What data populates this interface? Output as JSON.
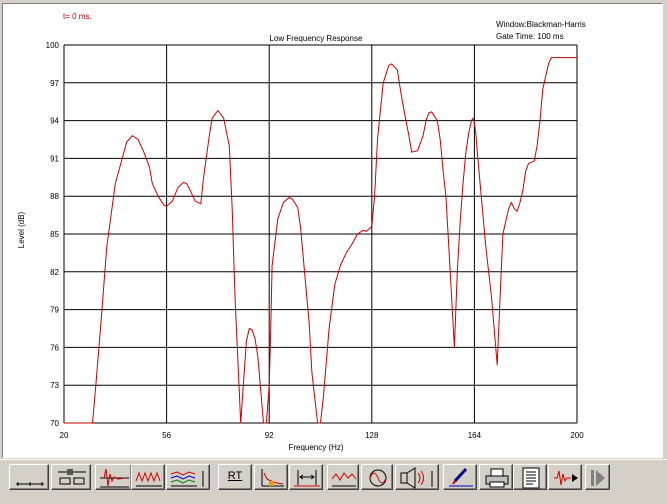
{
  "header": {
    "time_label": "t= 0 ms.",
    "window_info": "Window:Blackman-Harris",
    "gate_info": "Gate Time: 100 ms"
  },
  "chart_data": {
    "type": "line",
    "title": "Low Frequency Response",
    "xlabel": "Frequency (Hz)",
    "ylabel": "Level (dB)",
    "xlim": [
      20,
      200
    ],
    "ylim": [
      70,
      100
    ],
    "x_ticks": [
      "20",
      "56",
      "92",
      "128",
      "164",
      "200"
    ],
    "y_ticks": [
      "100",
      "97",
      "94",
      "91",
      "88",
      "85",
      "82",
      "79",
      "76",
      "73",
      "70"
    ],
    "grid": true,
    "line_color": "#cc0000",
    "series": [
      {
        "x": [
          20,
          30,
          31,
          33,
          35,
          38,
          42,
          44,
          46,
          48,
          50,
          51,
          53,
          55,
          56,
          58,
          60,
          62,
          63,
          64,
          66,
          68,
          69,
          71,
          72,
          74,
          76,
          78,
          79,
          80,
          82,
          84,
          85,
          86,
          87,
          88,
          90,
          91,
          92,
          92.5,
          93,
          95,
          97,
          99,
          100,
          102,
          103,
          104,
          106,
          107,
          109,
          110,
          111,
          113,
          115,
          117,
          119,
          121,
          123,
          125,
          126,
          127,
          128,
          129,
          130,
          132,
          134,
          135,
          137,
          138,
          139,
          140,
          141,
          142,
          144,
          146,
          147,
          148,
          149,
          151,
          152,
          153,
          154,
          155,
          156,
          157,
          158,
          159,
          160,
          161,
          162,
          163,
          163.5,
          164,
          164.5,
          165,
          166,
          168,
          170,
          172,
          173,
          174,
          176,
          177,
          178,
          179,
          180,
          181,
          182,
          183,
          185,
          186,
          187,
          188,
          190,
          191,
          192,
          193,
          194,
          195,
          196,
          197,
          198,
          199,
          200
        ],
        "y": [
          70,
          70,
          72.5,
          78,
          84,
          89,
          92.3,
          92.8,
          92.5,
          91.5,
          90.3,
          89,
          88,
          87.3,
          87.2,
          87.6,
          88.7,
          89.1,
          89,
          88.6,
          87.6,
          87.4,
          89.5,
          92.8,
          94.2,
          94.8,
          94.2,
          92,
          87,
          80,
          70,
          76.5,
          77.5,
          77.4,
          76.7,
          75.3,
          70,
          70,
          73,
          77,
          82.5,
          86.2,
          87.5,
          87.9,
          87.8,
          87.1,
          85.5,
          83,
          78,
          74,
          70,
          70,
          72,
          77.5,
          81,
          82.5,
          83.5,
          84.2,
          85,
          85.3,
          85.2,
          85.4,
          85.6,
          88,
          92.5,
          97,
          98.4,
          98.5,
          98,
          96.5,
          95.2,
          94,
          92.8,
          91.5,
          91.6,
          92.8,
          94,
          94.6,
          94.7,
          94,
          92.5,
          90,
          88,
          84,
          80,
          76,
          82,
          86,
          89,
          91.5,
          93,
          94,
          94.2,
          93.8,
          93,
          91.5,
          89,
          84,
          80,
          74.6,
          80,
          85,
          87,
          87.5,
          87,
          86.8,
          87.5,
          88.5,
          90,
          90.6,
          90.8,
          92,
          94,
          96.5,
          98.5,
          99,
          99,
          99,
          99,
          99,
          99,
          99,
          99,
          99,
          99
        ]
      }
    ]
  },
  "toolbar": {
    "rt_label": "RT",
    "buttons": [
      "baseline-icon",
      "slider-setup-icon",
      "impulse-icon",
      "waterfall-icon",
      "multi-response-icon",
      "rt-icon",
      "energy-time-icon",
      "gate-marker-icon",
      "frequency-response-icon",
      "phase-icon",
      "speaker-icon",
      "color-pen-icon",
      "printer-icon",
      "document-icon",
      "playback-icon",
      "next-icon"
    ]
  }
}
